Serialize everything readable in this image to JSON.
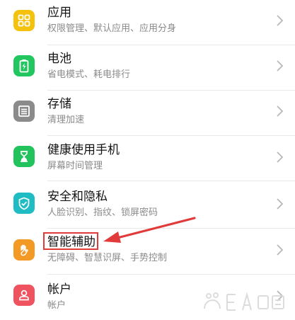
{
  "colors": {
    "apps": "#f4c20d",
    "battery": "#21c65e",
    "storage": "#8b8b8b",
    "health": "#22c35c",
    "security": "#1fbcc4",
    "accessibility": "#f39a26",
    "account": "#f05360",
    "annotation": "#e13a3a"
  },
  "items": [
    {
      "title": "应用",
      "subtitle": "权限管理、默认应用、应用分身",
      "icon": "apps-grid-icon"
    },
    {
      "title": "电池",
      "subtitle": "省电模式、耗电排行",
      "icon": "battery-icon"
    },
    {
      "title": "存储",
      "subtitle": "清理加速",
      "icon": "storage-icon"
    },
    {
      "title": "健康使用手机",
      "subtitle": "屏幕时间管理",
      "icon": "hourglass-icon"
    },
    {
      "title": "安全和隐私",
      "subtitle": "人脸识别、指纹、锁屏密码",
      "icon": "shield-check-icon"
    },
    {
      "title": "智能辅助",
      "subtitle": "无障碍、智慧识屏、手势控制",
      "icon": "hand-icon"
    },
    {
      "title": "帐户",
      "subtitle": "帐户",
      "icon": "account-icon"
    }
  ]
}
